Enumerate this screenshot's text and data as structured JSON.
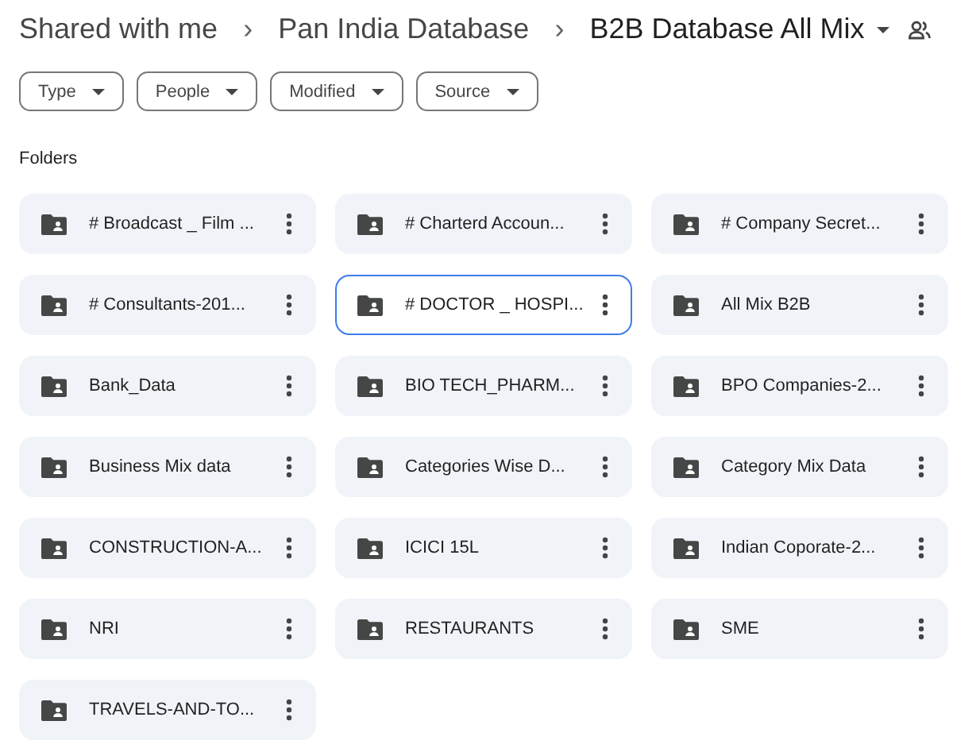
{
  "breadcrumb": [
    {
      "label": "Shared with me",
      "current": false
    },
    {
      "label": "Pan India Database",
      "current": false
    },
    {
      "label": "B2B Database All Mix",
      "current": true
    }
  ],
  "separator": "›",
  "filters": [
    "Type",
    "People",
    "Modified",
    "Source"
  ],
  "section_title": "Folders",
  "folders": [
    {
      "name": "# Broadcast _ Film ...",
      "selected": false
    },
    {
      "name": "# Charterd Accoun...",
      "selected": false
    },
    {
      "name": "# Company Secret...",
      "selected": false
    },
    {
      "name": "# Consultants-201...",
      "selected": false
    },
    {
      "name": "# DOCTOR _ HOSPI...",
      "selected": true
    },
    {
      "name": "All Mix B2B",
      "selected": false
    },
    {
      "name": "Bank_Data",
      "selected": false
    },
    {
      "name": "BIO TECH_PHARM...",
      "selected": false
    },
    {
      "name": "BPO Companies-2...",
      "selected": false
    },
    {
      "name": "Business Mix data",
      "selected": false
    },
    {
      "name": "Categories Wise D...",
      "selected": false
    },
    {
      "name": "Category Mix Data",
      "selected": false
    },
    {
      "name": "CONSTRUCTION-A...",
      "selected": false
    },
    {
      "name": "ICICI 15L",
      "selected": false
    },
    {
      "name": "Indian Coporate-2...",
      "selected": false
    },
    {
      "name": "NRI",
      "selected": false
    },
    {
      "name": "RESTAURANTS",
      "selected": false
    },
    {
      "name": "SME",
      "selected": false
    },
    {
      "name": "TRAVELS-AND-TO...",
      "selected": false
    }
  ]
}
